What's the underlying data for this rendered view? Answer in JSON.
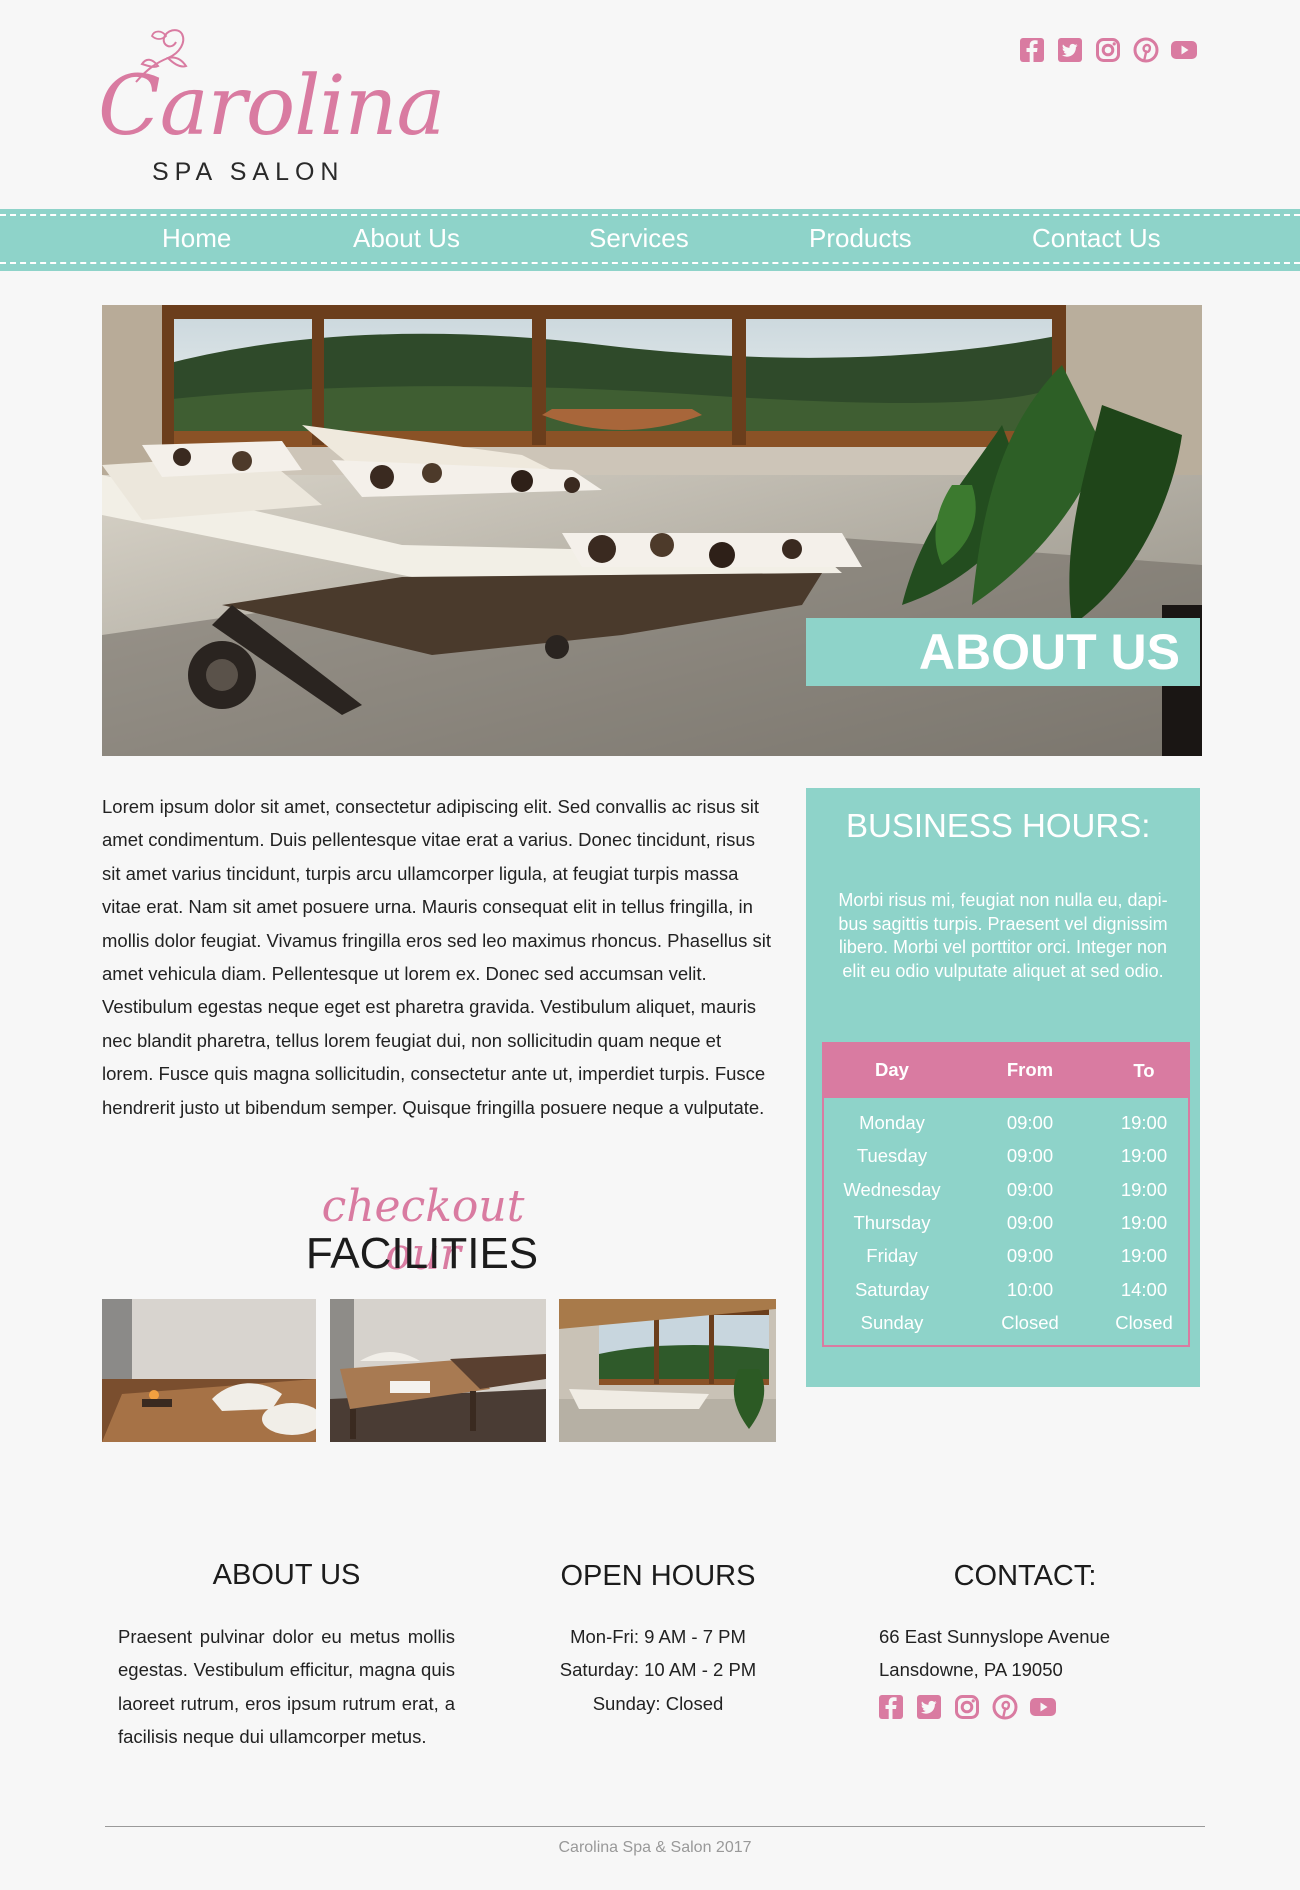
{
  "brand": {
    "script_name": "Carolina",
    "sub_name": "SPA SALON"
  },
  "social_icons": [
    "facebook-icon",
    "twitter-icon",
    "instagram-icon",
    "pinterest-icon",
    "youtube-icon"
  ],
  "colors": {
    "accent_teal": "#8ed3c9",
    "accent_pink": "#d97ba1",
    "background": "#f7f7f7"
  },
  "nav": {
    "items": [
      {
        "label": "Home"
      },
      {
        "label": "About Us"
      },
      {
        "label": "Services"
      },
      {
        "label": "Products"
      },
      {
        "label": "Contact Us"
      }
    ]
  },
  "hero": {
    "label": "ABOUT US"
  },
  "main": {
    "body_text": "Lorem ipsum dolor sit amet, consectetur adipiscing elit. Sed convallis ac risus sit amet condimentum. Duis pellentesque vitae erat a varius. Donec tincidunt, risus sit amet varius tincidunt, turpis arcu ullamcorper ligula, at feugiat turpis massa vitae erat. Nam sit amet posuere urna. Mauris consequat elit in tellus fringilla, in mollis dolor feugiat. Vivamus fringilla eros sed leo maximus rhoncus. Phasellus sit amet vehicula diam. Pellentesque ut lorem ex. Donec sed accumsan velit. Vestibulum egestas neque eget est pharetra gravida. Vestibulum aliquet, mauris nec blandit pharetra, tellus lorem feugiat dui, non sollicitudin quam neque et lorem. Fusce quis magna sollicitudin, consectetur ante ut, imperdiet turpis. Fusce hendrerit justo ut bibendum semper. Quisque fringilla posuere neque a vulputate.",
    "checkout_script": "checkout our",
    "facilities_title": "FACILITIES"
  },
  "business_hours": {
    "title": "BUSINESS HOURS:",
    "description": "Morbi risus mi, feugiat non nulla eu, dapi-bus sagittis turpis. Praesent vel dignissim libero. Morbi vel porttitor orci. Integer non elit eu odio vulputate aliquet at sed odio.",
    "columns": [
      "Day",
      "From",
      "To"
    ],
    "rows": [
      {
        "day": "Monday",
        "from": "09:00",
        "to": "19:00"
      },
      {
        "day": "Tuesday",
        "from": "09:00",
        "to": "19:00"
      },
      {
        "day": "Wednesday",
        "from": "09:00",
        "to": "19:00"
      },
      {
        "day": "Thursday",
        "from": "09:00",
        "to": "19:00"
      },
      {
        "day": "Friday",
        "from": "09:00",
        "to": "19:00"
      },
      {
        "day": "Saturday",
        "from": "10:00",
        "to": "14:00"
      },
      {
        "day": "Sunday",
        "from": "Closed",
        "to": "Closed"
      }
    ]
  },
  "footer": {
    "about_title": "ABOUT US",
    "about_text": "Praesent pulvinar dolor eu metus mollis egestas. Vestibulum efficitur, magna quis laoreet rutrum, eros ipsum rutrum erat, a facilisis neque dui ullamcorper metus.",
    "hours_title": "OPEN HOURS",
    "hours_lines": [
      "Mon-Fri: 9 AM - 7 PM",
      "Saturday: 10 AM - 2 PM",
      "Sunday: Closed"
    ],
    "contact_title": "CONTACT:",
    "address_line1": "66 East Sunnyslope Avenue",
    "address_line2": "Lansdowne, PA 19050",
    "copyright": "Carolina Spa & Salon 2017"
  }
}
